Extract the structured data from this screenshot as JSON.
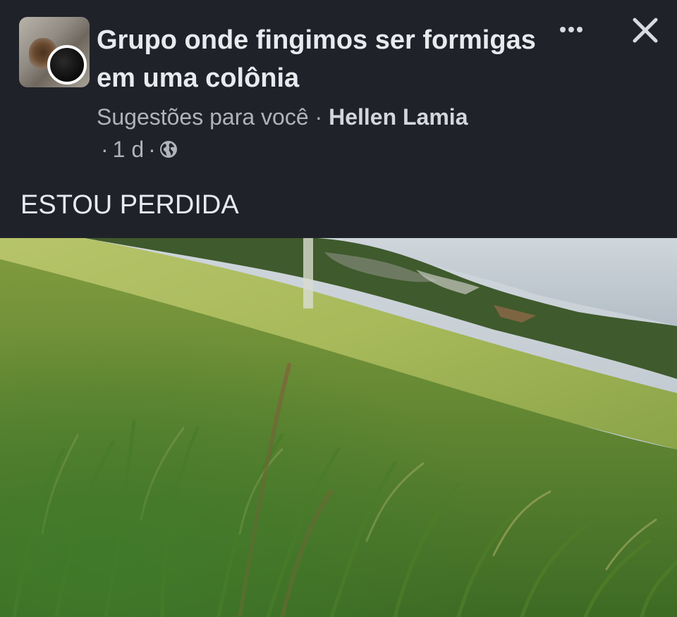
{
  "post": {
    "group_name": "Grupo onde fingimos ser formigas em uma colônia",
    "suggestion_label": "Sugestões para você",
    "separator": "·",
    "author": "Hellen Lamia",
    "time": "1 d",
    "privacy_icon": "globe-icon",
    "text": "ESTOU PERDIDA",
    "photo_description_icon": "photo"
  },
  "actions": {
    "more_icon": "more-horizontal-icon",
    "close_icon": "close-icon"
  },
  "colors": {
    "background": "#1f2229",
    "title": "#e9eaee",
    "meta": "#b0b3b8"
  }
}
